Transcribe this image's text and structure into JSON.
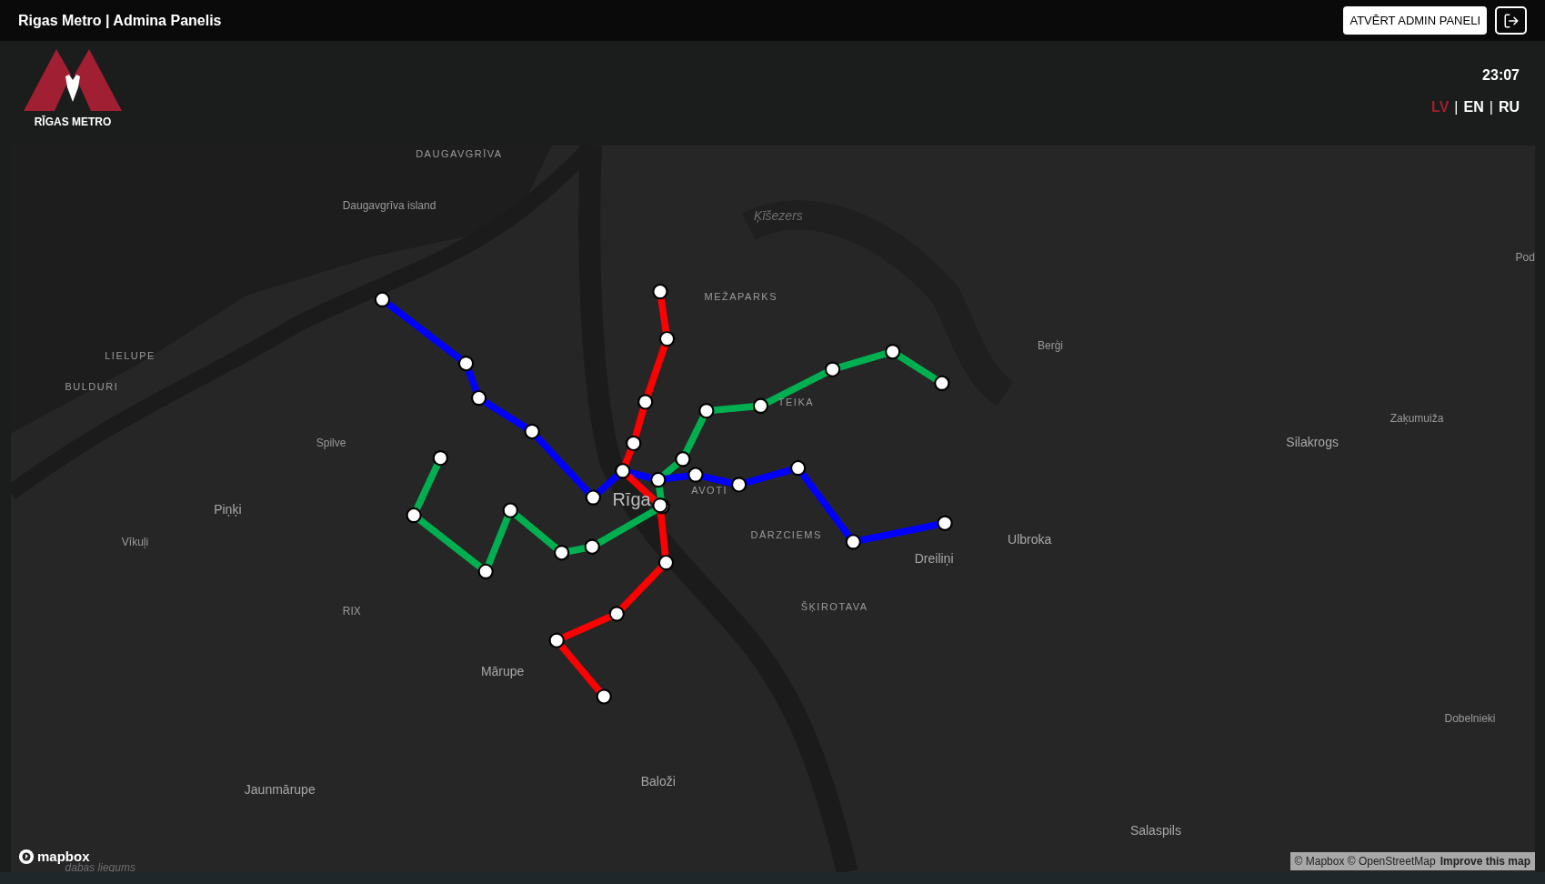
{
  "header": {
    "title": "Rigas Metro | Admina Panelis",
    "admin_button": "ATVĒRT ADMIN PANELI"
  },
  "logo": {
    "text": "RĪGAS METRO"
  },
  "clock": "23:07",
  "languages": [
    {
      "label": "LV",
      "selected": true
    },
    {
      "label": "EN",
      "selected": false
    },
    {
      "label": "RU",
      "selected": false
    }
  ],
  "language_separators": [
    "|",
    "|"
  ],
  "map": {
    "labels": [
      {
        "text": "DAUGAVGRĪVA",
        "kind": "district"
      },
      {
        "text": "Daugavgrīva island",
        "kind": "place"
      },
      {
        "text": "Ķīšezers",
        "kind": "water"
      },
      {
        "text": "Pod",
        "kind": "place"
      },
      {
        "text": "MEŽAPARKS",
        "kind": "district"
      },
      {
        "text": "Berģi",
        "kind": "place"
      },
      {
        "text": "LIELUPE",
        "kind": "district"
      },
      {
        "text": "BULDURI",
        "kind": "district"
      },
      {
        "text": "TEIKA",
        "kind": "district"
      },
      {
        "text": "Zaķumuiža",
        "kind": "place"
      },
      {
        "text": "Spilve",
        "kind": "place"
      },
      {
        "text": "Silakrogs",
        "kind": "town"
      },
      {
        "text": "AVOTI",
        "kind": "district"
      },
      {
        "text": "Piņķi",
        "kind": "town"
      },
      {
        "text": "Rīga",
        "kind": "city"
      },
      {
        "text": "Vīkuļi",
        "kind": "place"
      },
      {
        "text": "DĀRZCIEMS",
        "kind": "district"
      },
      {
        "text": "Ulbroka",
        "kind": "town"
      },
      {
        "text": "Dreiliņi",
        "kind": "town"
      },
      {
        "text": "RIX",
        "kind": "place"
      },
      {
        "text": "ŠĶIROTAVA",
        "kind": "district"
      },
      {
        "text": "Mārupe",
        "kind": "town"
      },
      {
        "text": "Dobelnieki",
        "kind": "place"
      },
      {
        "text": "Jaunmārupe",
        "kind": "town"
      },
      {
        "text": "Baloži",
        "kind": "town"
      },
      {
        "text": "Salaspils",
        "kind": "town"
      },
      {
        "text": "dabas liegums",
        "kind": "water"
      }
    ],
    "lines": [
      {
        "color": "#00b050"
      },
      {
        "color": "#0000ff"
      },
      {
        "color": "#ff0000"
      }
    ],
    "brand": "mapbox",
    "attribution": "© Mapbox © OpenStreetMap",
    "improve_link": "Improve this map"
  }
}
